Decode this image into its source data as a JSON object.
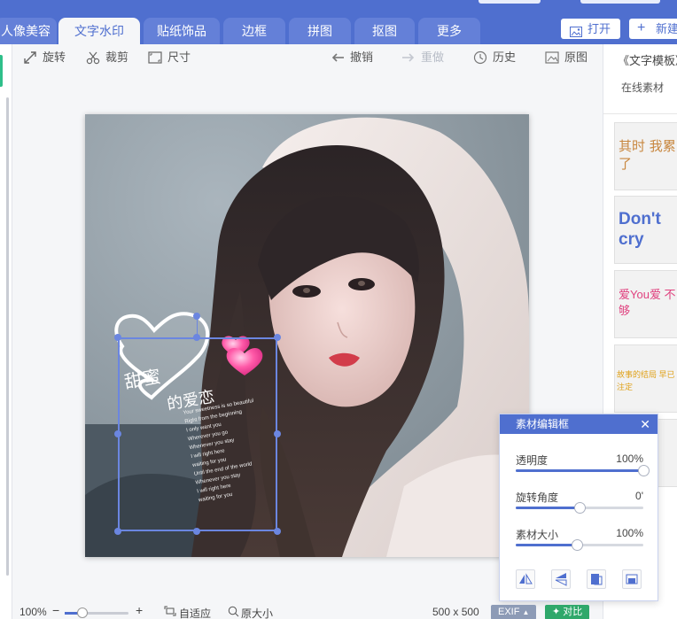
{
  "tabs": [
    {
      "label": "人像美容"
    },
    {
      "label": "文字水印"
    },
    {
      "label": "贴纸饰品"
    },
    {
      "label": "边框"
    },
    {
      "label": "拼图"
    },
    {
      "label": "抠图"
    },
    {
      "label": "更多"
    }
  ],
  "active_tab": "文字水印",
  "header_buttons": {
    "open": "打开",
    "new": "新建"
  },
  "left_strip": {
    "zoom_fragment": "%"
  },
  "toolbar": {
    "rotate": "旋转",
    "crop": "裁剪",
    "size": "尺寸",
    "undo": "撤销",
    "redo": "重做",
    "history": "历史",
    "original": "原图"
  },
  "right_panel": {
    "title": "《文字模板》",
    "online_materials": "在线素材",
    "thumbnails": [
      {
        "text": "其时 我累了"
      },
      {
        "text": "Don't cry"
      },
      {
        "text": "爱You爱 不够"
      },
      {
        "text": "故事的结局 早已注定"
      }
    ]
  },
  "overlay": {
    "headline_1": "甜蜜",
    "headline_2": "的爱恋",
    "lines": [
      "Your sweetness is so beautiful",
      "Right from the beginning",
      "I only want you",
      "Wherever you go",
      "Whenever you stay",
      "I will right here",
      "waiting for you",
      "Until the end of the world",
      "Whenever you stay",
      "I will right here",
      "waiting for you"
    ]
  },
  "dialog": {
    "title": "素材编辑框",
    "close": "✕",
    "opacity_label": "透明度",
    "opacity_value": "100%",
    "opacity_level": 1.0,
    "rotation_label": "旋转角度",
    "rotation_value": "0'",
    "rotation_level": 0.5,
    "size_label": "素材大小",
    "size_value": "100%",
    "size_level": 0.48
  },
  "status_bar": {
    "zoom": "100%",
    "minus": "−",
    "plus": "+",
    "fit": "自适应",
    "actual": "原大小",
    "dimensions": "500 x 500",
    "exif": "EXIF",
    "compare": "对比"
  },
  "colors": {
    "primary": "#4f6fcf",
    "active_tab_bg": "#f5f6f8",
    "compare_green": "#2fa86a",
    "exif_gray": "#8d9bb6"
  }
}
